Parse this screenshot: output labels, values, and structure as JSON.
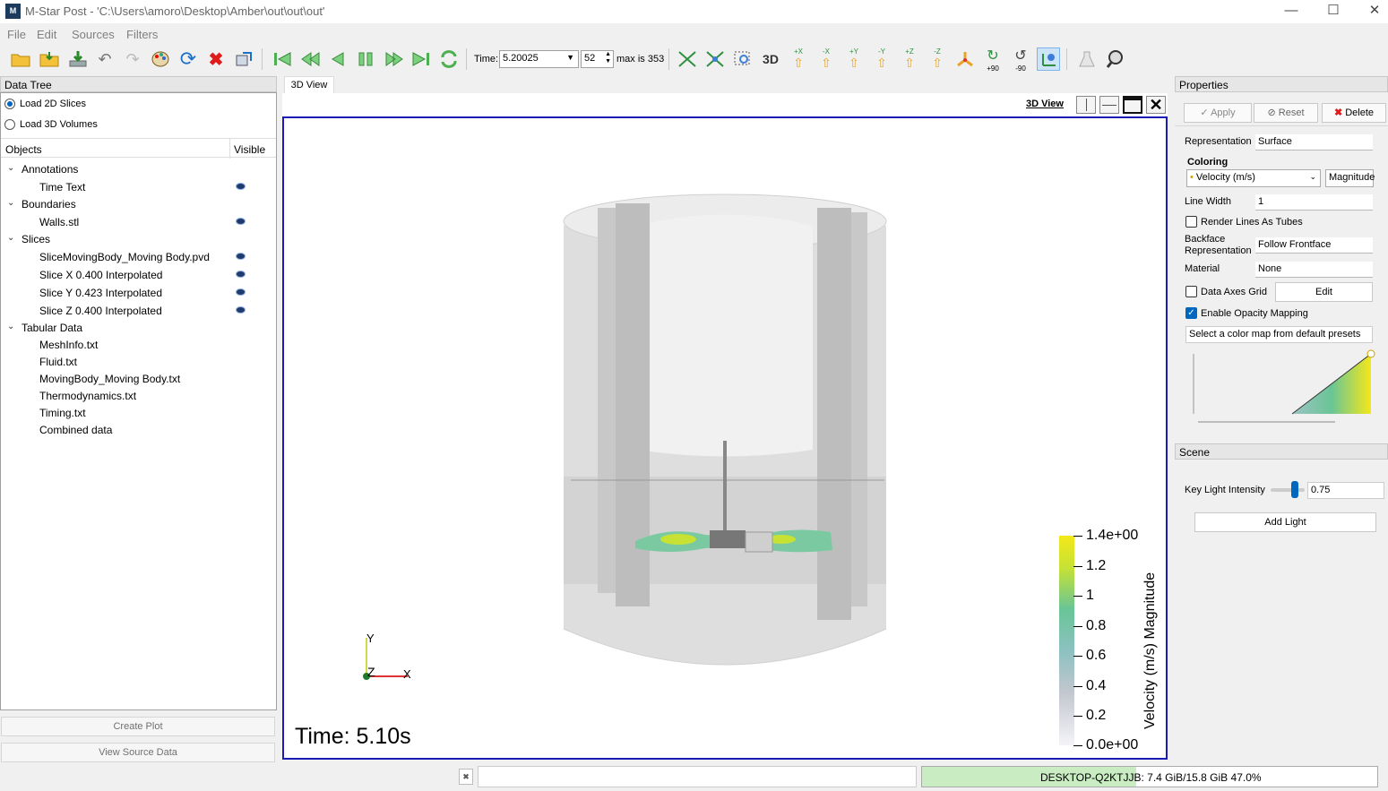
{
  "window": {
    "title": "M-Star Post - 'C:\\Users\\amoro\\Desktop\\Amber\\out\\out\\out'",
    "app_icon": "M",
    "minimize": "—",
    "maximize": "☐",
    "close": "✕"
  },
  "menu": [
    "File",
    "Edit",
    "Sources",
    "Filters"
  ],
  "toolbar": {
    "time_label": "Time:",
    "time_value": "5.20025",
    "step_value": "52",
    "max_label": "max is 353",
    "three_d": "3D",
    "axis_buttons": [
      "+X",
      "-X",
      "+Y",
      "-Y",
      "+Z",
      "-Z"
    ],
    "rot_plus": "+90",
    "rot_minus": "-90"
  },
  "datatree": {
    "header": "Data Tree",
    "load_2d": "Load 2D Slices",
    "load_3d": "Load 3D Volumes",
    "col_objects": "Objects",
    "col_visible": "Visible",
    "groups": [
      {
        "label": "Annotations",
        "items": [
          "Time Text"
        ]
      },
      {
        "label": "Boundaries",
        "items": [
          "Walls.stl"
        ]
      },
      {
        "label": "Slices",
        "items": [
          "SliceMovingBody_Moving Body.pvd",
          "Slice X 0.400 Interpolated",
          "Slice Y 0.423 Interpolated",
          "Slice Z 0.400 Interpolated"
        ]
      },
      {
        "label": "Tabular Data",
        "items": [
          "MeshInfo.txt",
          "Fluid.txt",
          "MovingBody_Moving Body.txt",
          "Thermodynamics.txt",
          "Timing.txt",
          "Combined data"
        ]
      }
    ],
    "create_plot": "Create Plot",
    "view_source": "View Source Data"
  },
  "view": {
    "tab": "3D View",
    "link": "3D View",
    "time_text": "Time: 5.10s",
    "legend_title": "Velocity (m/s) Magnitude",
    "legend_ticks": [
      "1.4e+00",
      "1.2",
      "1",
      "0.8",
      "0.6",
      "0.4",
      "0.2",
      "0.0e+00"
    ],
    "axis_labels": {
      "x": "X",
      "y": "Y",
      "z": "Z"
    }
  },
  "properties": {
    "header": "Properties",
    "apply": "Apply",
    "reset": "Reset",
    "delete": "Delete",
    "representation_label": "Representation",
    "representation_value": "Surface",
    "coloring_label": "Coloring",
    "coloring_value": "Velocity (m/s)",
    "coloring_mode": "Magnitude",
    "line_width_label": "Line Width",
    "line_width_value": "1",
    "render_tubes": "Render Lines As Tubes",
    "backface_label1": "Backface",
    "backface_label2": "Representation",
    "backface_value": "Follow Frontface",
    "material_label": "Material",
    "material_value": "None",
    "data_axes_grid": "Data Axes Grid",
    "edit": "Edit",
    "enable_opacity": "Enable Opacity Mapping",
    "colormap_preset": "Select a color map from default presets"
  },
  "scene": {
    "header": "Scene",
    "key_light_label": "Key Light Intensity",
    "key_light_value": "0.75",
    "key_light_level": 0.75,
    "add_light": "Add Light"
  },
  "status": {
    "host": "DESKTOP-Q2KTJJB: 7.4 GiB/15.8 GiB 47.0%",
    "memory_fraction": 0.47
  },
  "colors": {
    "accent": "#0067c0",
    "view_border": "#1b1bb8",
    "delete_red": "#e01b1b",
    "memory_green": "#c9ecc3"
  }
}
